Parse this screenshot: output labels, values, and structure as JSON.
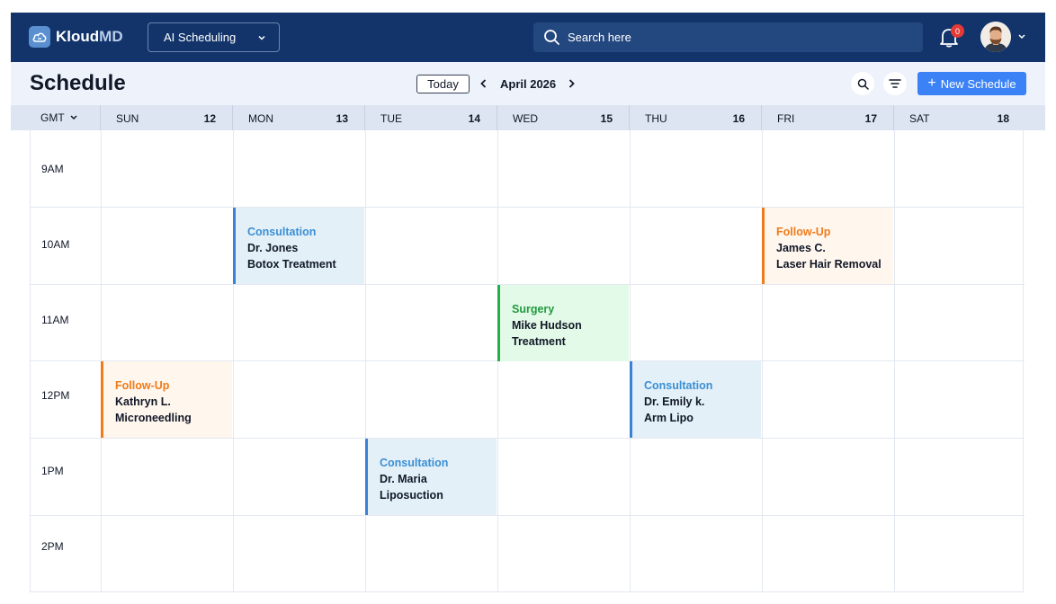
{
  "app": {
    "logo_text_a": "Kloud",
    "logo_text_b": "MD",
    "module": "AI Scheduling",
    "search_placeholder": "Search here",
    "notification_count": "0"
  },
  "toolbar": {
    "title": "Schedule",
    "today": "Today",
    "month": "April 2026",
    "new_schedule": "New Schedule"
  },
  "calendar": {
    "timezone": "GMT",
    "days": [
      {
        "name": "SUN",
        "num": "12"
      },
      {
        "name": "MON",
        "num": "13"
      },
      {
        "name": "TUE",
        "num": "14"
      },
      {
        "name": "WED",
        "num": "15"
      },
      {
        "name": "THU",
        "num": "16"
      },
      {
        "name": "FRI",
        "num": "17"
      },
      {
        "name": "SAT",
        "num": "18"
      }
    ],
    "times": [
      "9AM",
      "10AM",
      "11AM",
      "12PM",
      "1PM",
      "2PM"
    ],
    "events": [
      {
        "type": "Consultation",
        "patient": "Dr. Jones",
        "treatment": "Botox Treatment",
        "color": "#3b82d6"
      },
      {
        "type": "Follow-Up",
        "patient": "James C.",
        "treatment": "Laser Hair Removal",
        "color": "#f07b1a"
      },
      {
        "type": "Surgery",
        "patient": "Mike Hudson",
        "treatment": "Treatment",
        "color": "#22b04b"
      },
      {
        "type": "Follow-Up",
        "patient": "Kathryn L.",
        "treatment": "Microneedling",
        "color": "#f07b1a"
      },
      {
        "type": "Consultation",
        "patient": "Dr. Emily k.",
        "treatment": "Arm Lipo",
        "color": "#3b82d6"
      },
      {
        "type": "Consultation",
        "patient": "Dr. Maria",
        "treatment": "Liposuction",
        "color": "#3b82d6"
      }
    ]
  },
  "colors": {
    "nav": "#12346b",
    "accent": "#3b82f6",
    "consultation": "#3b82d6",
    "follow_up": "#f07b1a",
    "surgery": "#22b04b",
    "badge": "#e53935"
  }
}
